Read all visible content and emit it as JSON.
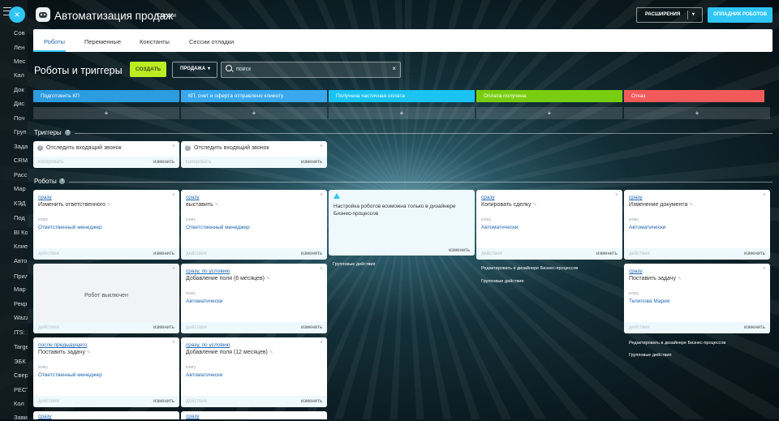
{
  "sidebar": {
    "items": [
      "Сов",
      "Лен",
      "Мес",
      "Кал",
      "Док",
      "Дис",
      "Поч",
      "Груп",
      "Зада",
      "CRM",
      "Расс",
      "Мар",
      "КЭД",
      "Под",
      "BI Ко",
      "Клие",
      "Авто",
      "Прил",
      "Мар",
      "Рекр",
      "Wazz",
      "ITS: 1",
      "Targe",
      "ЭБК",
      "Свер",
      "РЕСТ",
      "Кол",
      "Зави"
    ]
  },
  "header": {
    "title": "Автоматизация продаж",
    "subtitle": "Сделки",
    "extensions_label": "РАСШИРЕНИЯ",
    "publish_label": "ОПЛАДНИК РОБОТОВ"
  },
  "tabs": [
    "Роботы",
    "Переменные",
    "Константы",
    "Сессии отладки"
  ],
  "toolbar": {
    "title": "Роботы и триггеры",
    "create_label": "СОЗДАТЬ",
    "funnel_label": "ПРОДАЖА",
    "search_placeholder": "поиск"
  },
  "stages": [
    {
      "label": "Подготовить КП",
      "color": "#2c9bdf"
    },
    {
      "label": "КП, счет и оферта отправлено клиенту",
      "color": "#39a8ef"
    },
    {
      "label": "Получена частичная оплата",
      "color": "#1ac3f2"
    },
    {
      "label": "Оплата получена",
      "color": "#79cd11"
    },
    {
      "label": "Отказ",
      "color": "#f25a5a"
    }
  ],
  "add_label": "+",
  "sections": {
    "triggers": "Триггеры",
    "robots": "Роботы",
    "help": "?"
  },
  "common": {
    "copy": "копировать",
    "edit": "изменить",
    "actions": "действия",
    "whom": "кому",
    "close": "×",
    "pen": "✎"
  },
  "triggers": [
    {
      "name": "Отследить входящий звонок"
    },
    {
      "name": "Отследить входящий звонок"
    }
  ],
  "robots": {
    "r1c1": {
      "delay": "сразу",
      "name": "Изменить ответственного",
      "who": "Ответственный менеджер"
    },
    "r1c2": {
      "delay": "сразу",
      "name": "выставить",
      "who": "Ответственный менеджер"
    },
    "r1c3_warning": "Настройка роботов возможна только в дизайнере Бизнес-процессов",
    "r1c4": {
      "delay": "сразу",
      "name": "Копировать сделку",
      "who": "Автоматически"
    },
    "r1c5": {
      "delay": "сразу",
      "name": "Изменение документа",
      "who": "Автоматически"
    },
    "r2c1_disabled": "Робот выключен",
    "r2c2": {
      "delay": "сразу, по условию",
      "name": "Добавление поля (6 месяцев)",
      "who": "Автоматически"
    },
    "r2c5": {
      "delay": "сразу",
      "name": "Поставить задачу",
      "who": "Телипова Мария"
    },
    "r3c1": {
      "delay": "после предыдущего",
      "name": "Поставить задачу",
      "who": "Ответственный менеджер"
    },
    "r3c2": {
      "delay": "сразу, по условию",
      "name": "Добавление поля (12 месяцев)",
      "who": "Автоматически"
    },
    "r4c1": {
      "delay": "сразу"
    },
    "r4c2": {
      "delay": "сразу"
    }
  },
  "group_actions": "Групповые действия",
  "edit_in_designer": "Редактировать в дизайнере Бизнес-процессов"
}
